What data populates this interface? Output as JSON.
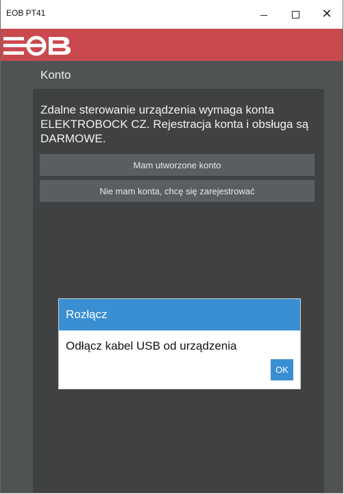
{
  "window": {
    "title": "EOB PT41",
    "minimize_icon": "minimize-icon",
    "maximize_icon": "maximize-icon",
    "close_icon": "close-icon"
  },
  "brand": {
    "logo_text": "EOB",
    "color": "#c9494f"
  },
  "section": {
    "title": "Konto"
  },
  "main": {
    "description": "Zdalne sterowanie urządzenia wymaga konta ELEKTROBOCK CZ. Rejestracja konta i obsługa są DARMOWE.",
    "have_account_label": "Mam utworzone konto",
    "register_label": "Nie mam konta, chcę się zarejestrować"
  },
  "dialog": {
    "title": "Rozłącz",
    "message": "Odłącz kabel USB od urządzenia",
    "ok_label": "OK",
    "accent": "#3a8fd2"
  }
}
